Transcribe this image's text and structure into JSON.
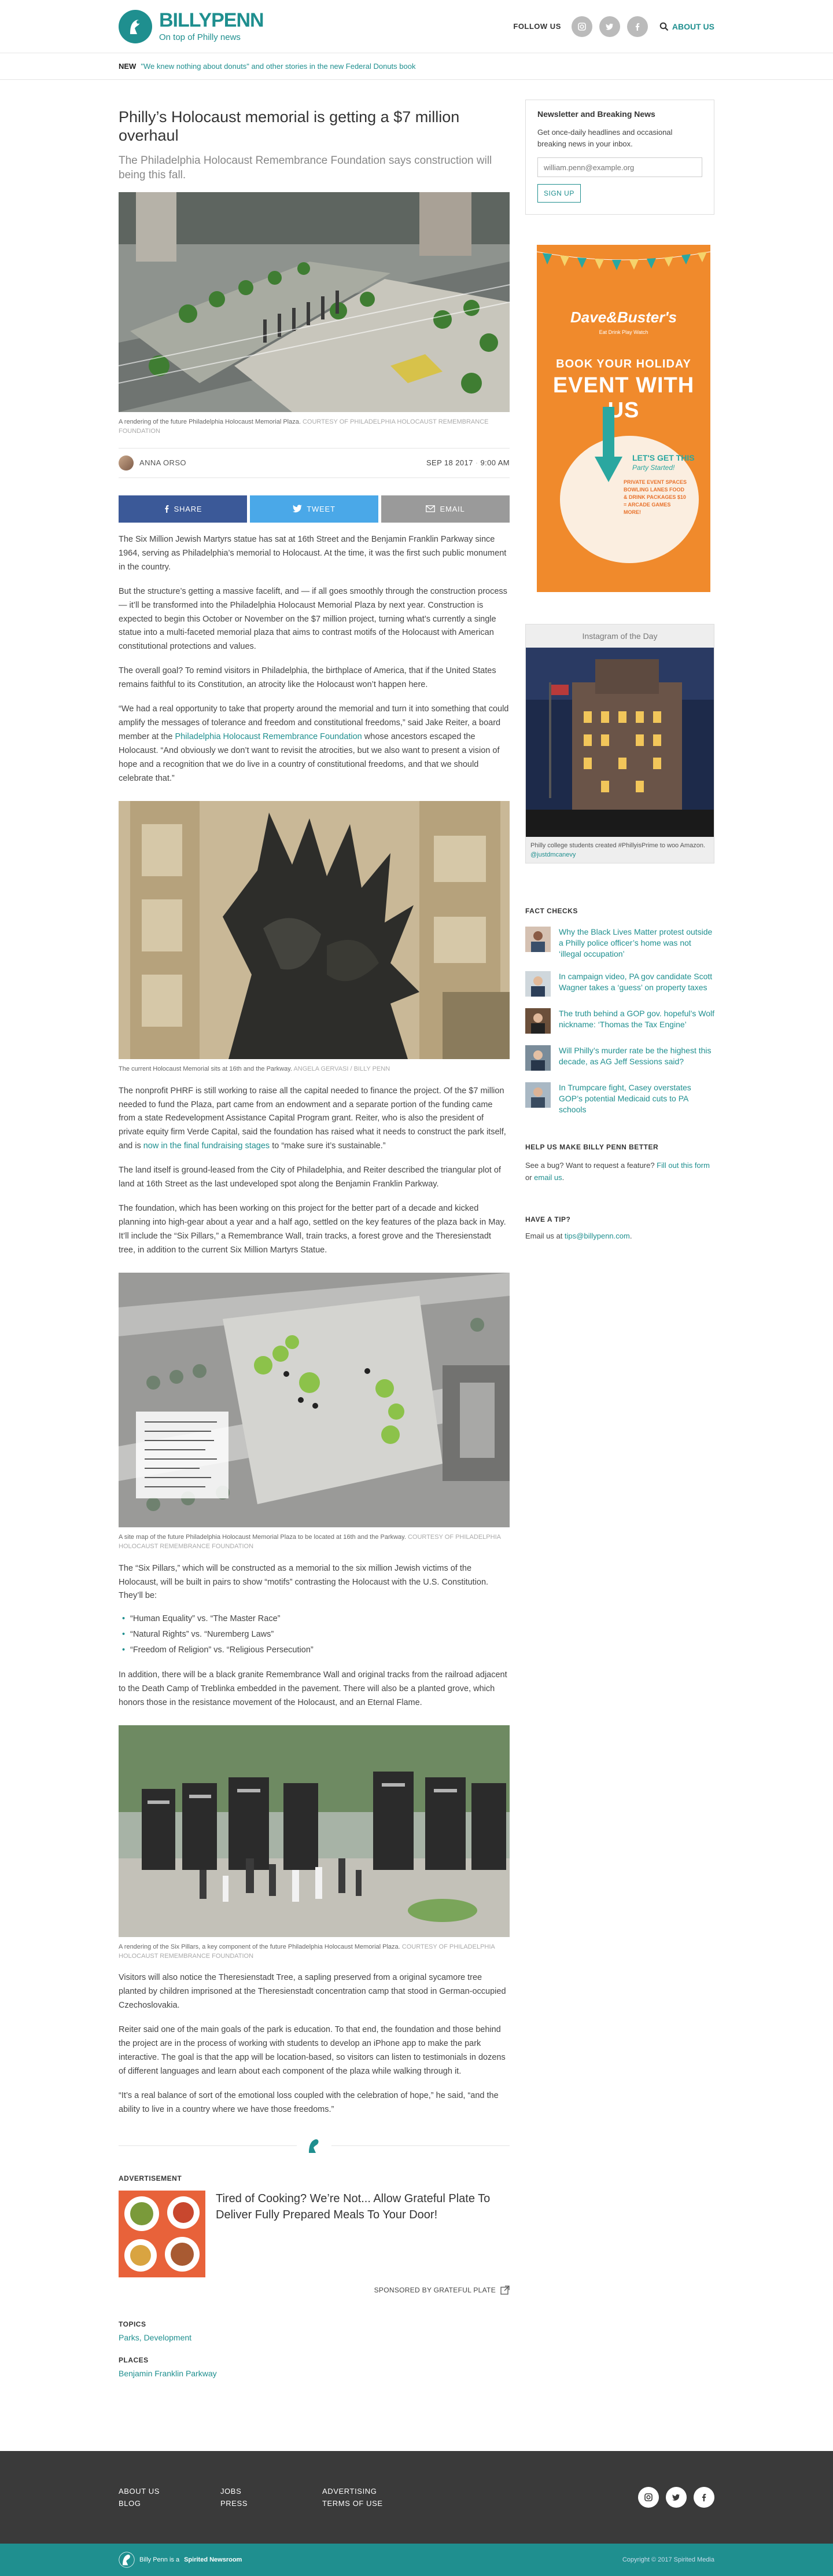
{
  "header": {
    "logo_name": "BILLYPENN",
    "logo_tag": "On top of Philly news",
    "follow_label": "FOLLOW US",
    "about_label": "ABOUT US"
  },
  "new_bar": {
    "label": "NEW",
    "link": "\"We knew nothing about donuts\" and other stories in the new Federal Donuts book"
  },
  "article": {
    "headline": "Philly’s Holocaust memorial is getting a $7 million overhaul",
    "dek": "The Philadelphia Holocaust Remembrance Foundation says construction will being this fall.",
    "fig1_caption": "A rendering of the future Philadelphia Holocaust Memorial Plaza.",
    "fig1_credit": "COURTESY OF PHILADELPHIA HOLOCAUST REMEMBRANCE FOUNDATION",
    "author": "ANNA ORSO",
    "date": "SEP 18 2017",
    "time": "9:00 AM",
    "share_fb": "SHARE",
    "share_tw": "TWEET",
    "share_email": "EMAIL",
    "p1": "The Six Million Jewish Martyrs statue has sat at 16th Street and the Benjamin Franklin Parkway since 1964, serving as Philadelphia’s memorial to Holocaust. At the time, it was the first such public monument in the country.",
    "p2": "But the structure’s getting a massive facelift, and — if all goes smoothly through the construction process — it’ll be transformed into the Philadelphia Holocaust Memorial Plaza by next year. Construction is expected to begin this October or November on the $7 million project, turning what’s currently a single statue into a multi-faceted memorial plaza that aims to contrast motifs of the Holocaust with American constitutional protections and values.",
    "p3": "The overall goal? To remind visitors in Philadelphia, the birthplace of America, that if the United States remains faithful to its Constitution, an atrocity like the Holocaust won’t happen here.",
    "p4a": "“We had a real opportunity to take that property around the memorial and turn it into something that could amplify the messages of tolerance and freedom and constitutional freedoms,” said Jake Reiter, a board member at the ",
    "p4_link": "Philadelphia Holocaust Remembrance Foundation",
    "p4b": " whose ancestors escaped the Holocaust. “And obviously we don’t want to revisit the atrocities, but we also want to present a vision of hope and a recognition that we do live in a country of constitutional freedoms, and that we should celebrate that.”",
    "fig2_caption": "The current Holocaust Memorial sits at 16th and the Parkway.",
    "fig2_credit": "ANGELA GERVASI / BILLY PENN",
    "p5a": "The nonprofit PHRF is still working to raise all the capital needed to finance the project. Of the $7 million needed to fund the Plaza, part came from an endowment and a separate portion of the funding came from a state Redevelopment Assistance Capital Program grant. Reiter, who is also the president of private equity firm Verde Capital, said the foundation has raised what it needs to construct the park itself, and is ",
    "p5_link": "now in the final fundraising stages",
    "p5b": " to “make sure it’s sustainable.”",
    "p6": "The land itself is ground-leased from the City of Philadelphia, and Reiter described the triangular plot of land at 16th Street as the last undeveloped spot along the Benjamin Franklin Parkway.",
    "p7": "The foundation, which has been working on this project for the better part of a decade and kicked planning into high-gear about a year and a half ago, settled on the key features of the plaza back in May. It’ll include the “Six Pillars,” a Remembrance Wall, train tracks, a forest grove and the Theresienstadt tree, in addition to the current Six Million Martyrs Statue.",
    "fig3_caption": "A site map of the future Philadelphia Holocaust Memorial Plaza to be located at 16th and the Parkway.",
    "fig3_credit": "COURTESY OF PHILADELPHIA HOLOCAUST REMEMBRANCE FOUNDATION",
    "p8": "The “Six Pillars,” which will be constructed as a memorial to the six million Jewish victims of the Holocaust, will be built in pairs to show “motifs” contrasting the Holocaust with the U.S. Constitution. They’ll be:",
    "bullets": [
      "“Human Equality” vs. “The Master Race”",
      "“Natural Rights” vs. “Nuremberg Laws”",
      "“Freedom of Religion” vs. “Religious Persecution”"
    ],
    "p9": "In addition, there will be a black granite Remembrance Wall and original tracks from the railroad adjacent to the Death Camp of Treblinka embedded in the pavement. There will also be a planted grove, which honors those in the resistance movement of the Holocaust, and an Eternal Flame.",
    "fig4_caption": "A rendering of the Six Pillars, a key component of the future Philadelphia Holocaust Memorial Plaza.",
    "fig4_credit": "COURTESY OF PHILADELPHIA HOLOCAUST REMEMBRANCE FOUNDATION",
    "p10": "Visitors will also notice the Theresienstadt Tree, a sapling preserved from a original sycamore tree planted by children imprisoned at the Theresienstadt concentration camp that stood in German-occupied Czechoslovakia.",
    "p11": "Reiter said one of the main goals of the park is education. To that end, the foundation and those behind the project are in the process of working with students to develop an iPhone app to make the park interactive. The goal is that the app will be location-based, so visitors can listen to testimonials in dozens of different languages and learn about each component of the plaza while walking through it.",
    "p12": "“It’s a real balance of sort of the emotional loss coupled with the celebration of hope,” he said, “and the ability to live in a country where we have those freedoms.”"
  },
  "advert": {
    "label": "ADVERTISEMENT",
    "title": "Tired of Cooking? We’re Not... Allow Grateful Plate To Deliver Fully Prepared Meals To Your Door!",
    "sponsor": "SPONSORED BY GRATEFUL PLATE"
  },
  "taxonomy": {
    "topics_label": "TOPICS",
    "topics_value": "Parks, Development",
    "places_label": "PLACES",
    "places_value": "Benjamin Franklin Parkway"
  },
  "sidebar": {
    "nl_title": "Newsletter and Breaking News",
    "nl_text": "Get once-daily headlines and occasional breaking news in your inbox.",
    "nl_placeholder": "william.penn@example.org",
    "nl_button": "SIGN UP",
    "ad_brand": "Dave&Buster's",
    "ad_sub": "Eat Drink Play Watch",
    "ad_h1": "BOOK YOUR HOLIDAY",
    "ad_h2": "EVENT WITH US",
    "ad_l1": "LET'S GET THIS",
    "ad_l2": "Party Started!",
    "ad_l3": "PRIVATE EVENT SPACES BOWLING LANES FOOD & DRINK PACKAGES $10 = ARCADE GAMES MORE!",
    "ig_title": "Instagram of the Day",
    "ig_caption": "Philly college students created #PhillyisPrime to woo Amazon.",
    "ig_user": "@justdmcanevy",
    "fc_title": "FACT CHECKS",
    "fact_checks": [
      "Why the Black Lives Matter protest outside a Philly police officer’s home was not ‘illegal occupation’",
      "In campaign video, PA gov candidate Scott Wagner takes a ‘guess’ on property taxes",
      "The truth behind a GOP gov. hopeful’s Wolf nickname: ‘Thomas the Tax Engine’",
      "Will Philly’s murder rate be the highest this decade, as AG Jeff Sessions said?",
      "In Trumpcare fight, Casey overstates GOP’s potential Medicaid cuts to PA schools"
    ],
    "help_title": "HELP US MAKE BILLY PENN BETTER",
    "help_text_a": "See a bug? Want to request a feature? ",
    "help_link1": "Fill out this form",
    "help_text_b": " or ",
    "help_link2": "email us",
    "help_text_c": ".",
    "tip_title": "HAVE A TIP?",
    "tip_text": "Email us at ",
    "tip_link": "tips@billypenn.com",
    "tip_end": "."
  },
  "footer": {
    "links": [
      "ABOUT US",
      "JOBS",
      "ADVERTISING",
      "BLOG",
      "PRESS",
      "TERMS OF USE"
    ],
    "bottom_left_a": "Billy Penn is a",
    "bottom_left_b": "Spirited Newsroom",
    "copyright": "Copyright © 2017 Spirited Media"
  },
  "colors": {
    "brand": "#1f8f8f",
    "facebook": "#3b5998",
    "twitter": "#4aa8e8",
    "email": "#9a9a9a",
    "footer": "#3a3a3a"
  }
}
